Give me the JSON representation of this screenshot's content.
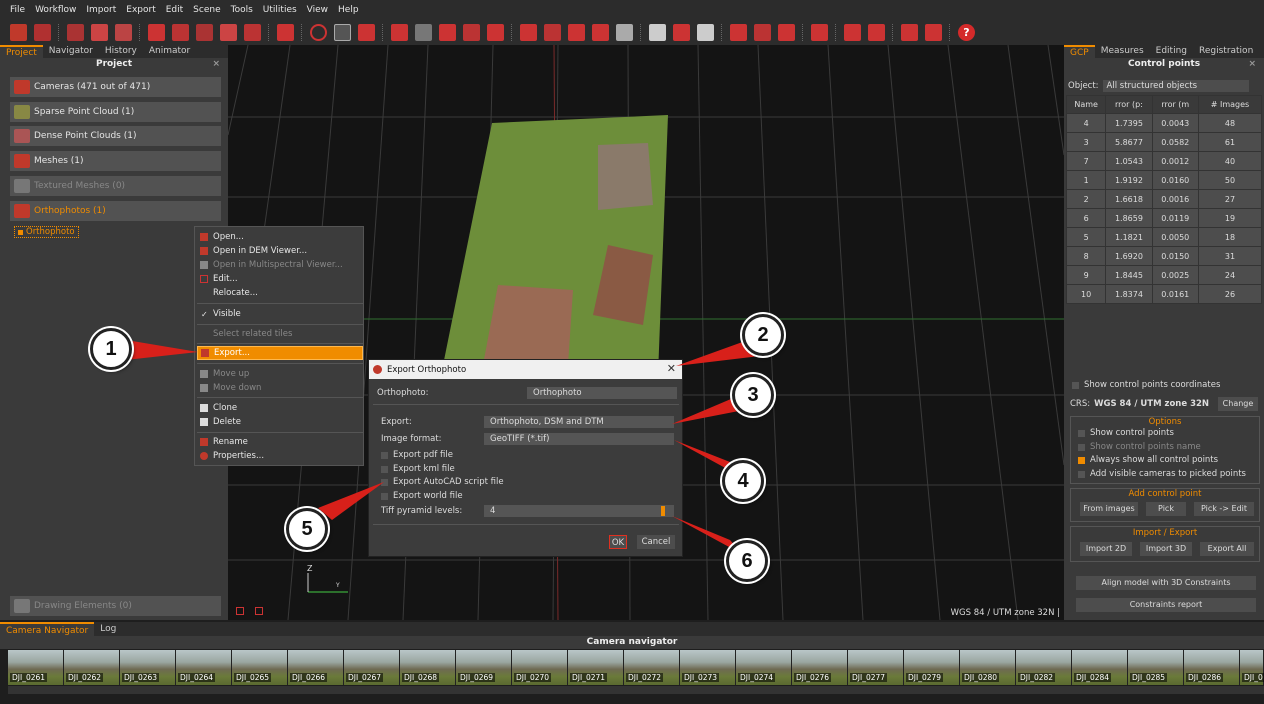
{
  "menubar": [
    "File",
    "Workflow",
    "Import",
    "Export",
    "Edit",
    "Scene",
    "Tools",
    "Utilities",
    "View",
    "Help"
  ],
  "toolbar": {
    "help_label": "?"
  },
  "left_panel": {
    "tabs": [
      "Project",
      "Navigator",
      "History",
      "Animator"
    ],
    "title": "Project",
    "close": "×",
    "items": {
      "cameras": "Cameras (471 out of 471)",
      "sparse": "Sparse Point Cloud (1)",
      "dense": "Dense Point Clouds (1)",
      "meshes": "Meshes (1)",
      "textured": "Textured Meshes (0)",
      "orthophotos": "Orthophotos (1)",
      "drawing": "Drawing Elements (0)"
    },
    "tree_item": "Orthophoto"
  },
  "context_menu": {
    "open": "Open...",
    "open_dem": "Open in DEM Viewer...",
    "open_multi": "Open in Multispectral Viewer...",
    "edit": "Edit...",
    "relocate": "Relocate...",
    "visible": "Visible",
    "visible_check": "✓",
    "select_related": "Select related tiles",
    "export": "Export...",
    "move_up": "Move up",
    "move_down": "Move down",
    "clone": "Clone",
    "delete": "Delete",
    "rename": "Rename",
    "properties": "Properties..."
  },
  "dialog": {
    "title": "Export Orthophoto",
    "close": "✕",
    "orthophoto_label": "Orthophoto:",
    "orthophoto_value": "Orthophoto",
    "export_label": "Export:",
    "export_value": "Orthophoto, DSM and DTM",
    "format_label": "Image format:",
    "format_value": "GeoTIFF (*.tif)",
    "pdf": "Export pdf file",
    "kml": "Export kml file",
    "autocad": "Export AutoCAD script file",
    "world": "Export world file",
    "tiff_label": "Tiff pyramid levels:",
    "tiff_value": "4",
    "ok": "OK",
    "cancel": "Cancel"
  },
  "viewport": {
    "crs_status": "WGS 84 / UTM zone 32N |",
    "axis_z": "Z",
    "axis_y": "Y"
  },
  "callouts": [
    "1",
    "2",
    "3",
    "4",
    "5",
    "6"
  ],
  "right_panel": {
    "tabs": [
      "GCP",
      "Measures",
      "Editing",
      "Registration"
    ],
    "title": "Control points",
    "object_label": "Object:",
    "object_value": "All structured objects",
    "columns": [
      "Name",
      "rror (p:",
      "rror (m",
      "# Images"
    ],
    "rows": [
      [
        "4",
        "1.7395",
        "0.0043",
        "48"
      ],
      [
        "3",
        "5.8677",
        "0.0582",
        "61"
      ],
      [
        "7",
        "1.0543",
        "0.0012",
        "40"
      ],
      [
        "1",
        "1.9192",
        "0.0160",
        "50"
      ],
      [
        "2",
        "1.6618",
        "0.0016",
        "27"
      ],
      [
        "6",
        "1.8659",
        "0.0119",
        "19"
      ],
      [
        "5",
        "1.1821",
        "0.0050",
        "18"
      ],
      [
        "8",
        "1.6920",
        "0.0150",
        "31"
      ],
      [
        "9",
        "1.8445",
        "0.0025",
        "24"
      ],
      [
        "10",
        "1.8374",
        "0.0161",
        "26"
      ]
    ],
    "show_coords": "Show control points coordinates",
    "crs_label": "CRS:",
    "crs_value": "WGS 84 / UTM zone 32N",
    "change": "Change",
    "options_title": "Options",
    "opt_show": "Show control points",
    "opt_show_name": "Show control points name",
    "opt_always": "Always show all control points",
    "opt_add_visible": "Add visible cameras to picked points",
    "add_cp_title": "Add control point",
    "from_images": "From images",
    "pick": "Pick",
    "pick_edit": "Pick -> Edit",
    "import_export_title": "Import / Export",
    "import2d": "Import 2D",
    "import3d": "Import 3D",
    "export_all": "Export All",
    "align": "Align model with 3D Constraints",
    "constraints_report": "Constraints report"
  },
  "bottom": {
    "tabs": [
      "Camera Navigator",
      "Log"
    ],
    "title": "Camera navigator",
    "thumbs": [
      "DJI_0261",
      "DJI_0262",
      "DJI_0263",
      "DJI_0264",
      "DJI_0265",
      "DJI_0266",
      "DJI_0267",
      "DJI_0268",
      "DJI_0269",
      "DJI_0270",
      "DJI_0271",
      "DJI_0272",
      "DJI_0273",
      "DJI_0274",
      "DJI_0276",
      "DJI_0277",
      "DJI_0279",
      "DJI_0280",
      "DJI_0282",
      "DJI_0284",
      "DJI_0285",
      "DJI_0286",
      "DJI_0"
    ]
  }
}
